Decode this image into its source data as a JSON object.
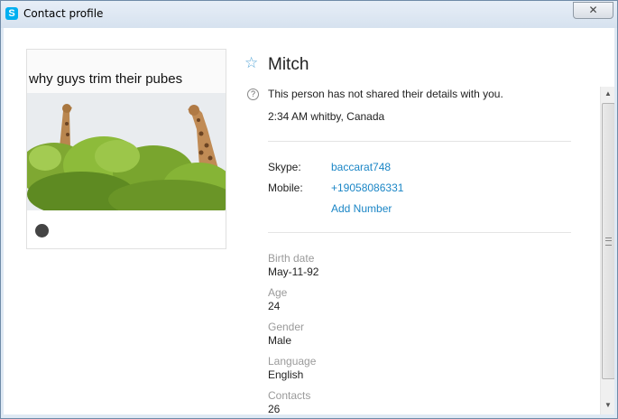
{
  "window": {
    "title": "Contact profile",
    "close_icon": "close-icon",
    "app_icon": "skype-icon"
  },
  "photo": {
    "caption": "why guys trim their pubes"
  },
  "profile": {
    "name": "Mitch",
    "notice": "This person has not shared their details with you.",
    "local_time": "2:34 AM whitby, Canada"
  },
  "contact": {
    "skype_label": "Skype:",
    "skype_value": "baccarat748",
    "mobile_label": "Mobile:",
    "mobile_value": "+19058086331",
    "add_number": "Add Number"
  },
  "details": {
    "birth_label": "Birth date",
    "birth_value": "May-11-92",
    "age_label": "Age",
    "age_value": "24",
    "gender_label": "Gender",
    "gender_value": "Male",
    "language_label": "Language",
    "language_value": "English",
    "contacts_label": "Contacts",
    "contacts_value": "26"
  },
  "colors": {
    "link": "#1b86c6",
    "label": "#9a9a9a",
    "accent": "#00aff0"
  }
}
